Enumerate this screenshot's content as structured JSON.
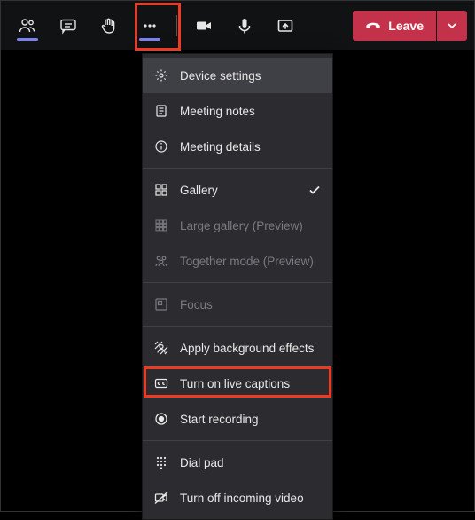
{
  "toolbar": {
    "leave_label": "Leave"
  },
  "menu": {
    "device_settings": "Device settings",
    "meeting_notes": "Meeting notes",
    "meeting_details": "Meeting details",
    "gallery": "Gallery",
    "large_gallery": "Large gallery (Preview)",
    "together_mode": "Together mode (Preview)",
    "focus": "Focus",
    "apply_bg": "Apply background effects",
    "live_captions": "Turn on live captions",
    "start_recording": "Start recording",
    "dial_pad": "Dial pad",
    "turn_off_incoming": "Turn off incoming video"
  }
}
